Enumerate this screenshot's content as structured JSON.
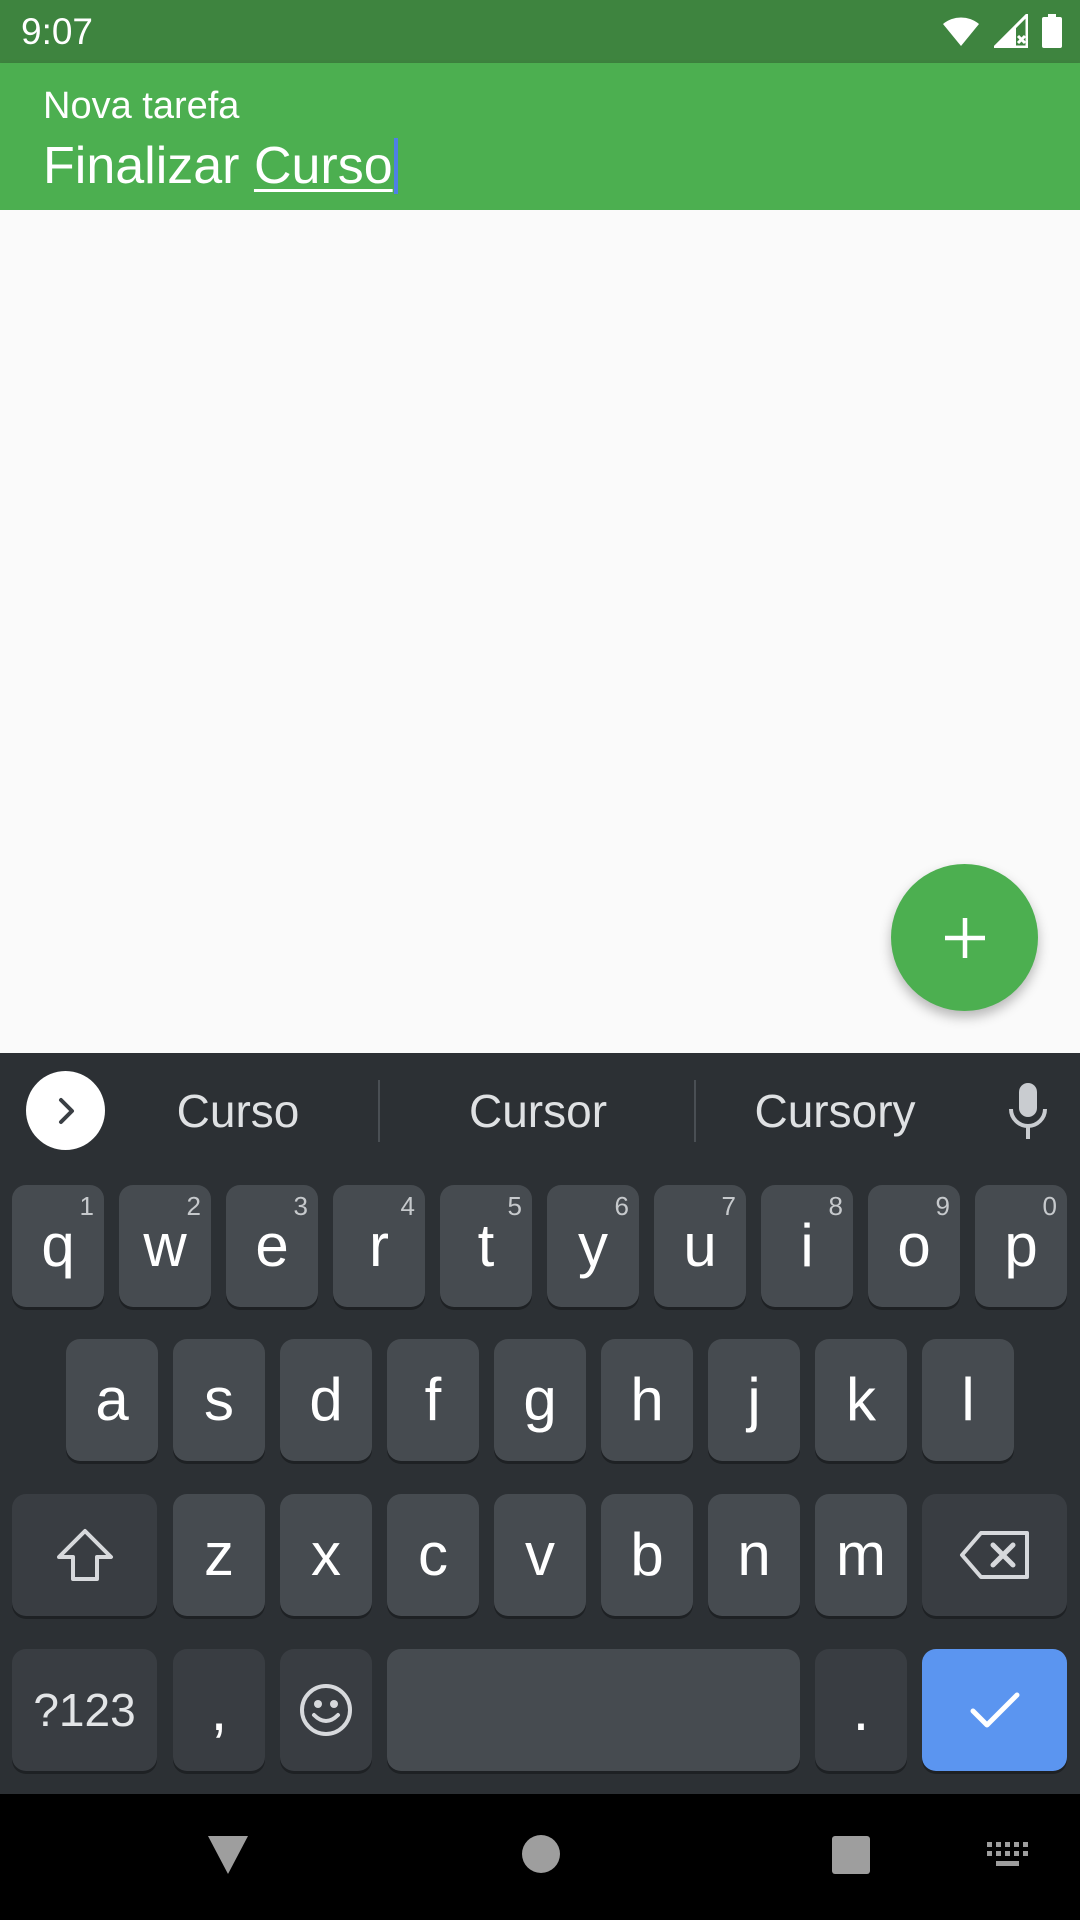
{
  "status_bar": {
    "time": "9:07",
    "icons": [
      "wifi-icon",
      "signal-icon",
      "battery-icon"
    ]
  },
  "task_input": {
    "label": "Nova tarefa",
    "text_prefix": "Finalizar ",
    "text_composing": "Curso"
  },
  "fab": {
    "icon": "add-icon",
    "color": "#4caf50"
  },
  "keyboard": {
    "suggestions": [
      "Curso",
      "Cursor",
      "Cursory"
    ],
    "row1": [
      {
        "label": "q",
        "hint": "1"
      },
      {
        "label": "w",
        "hint": "2"
      },
      {
        "label": "e",
        "hint": "3"
      },
      {
        "label": "r",
        "hint": "4"
      },
      {
        "label": "t",
        "hint": "5"
      },
      {
        "label": "y",
        "hint": "6"
      },
      {
        "label": "u",
        "hint": "7"
      },
      {
        "label": "i",
        "hint": "8"
      },
      {
        "label": "o",
        "hint": "9"
      },
      {
        "label": "p",
        "hint": "0"
      }
    ],
    "row2": [
      "a",
      "s",
      "d",
      "f",
      "g",
      "h",
      "j",
      "k",
      "l"
    ],
    "row3": [
      "z",
      "x",
      "c",
      "v",
      "b",
      "n",
      "m"
    ],
    "symbols_label": "?123",
    "comma_label": ",",
    "period_label": "."
  },
  "colors": {
    "status_bar": "#3e843f",
    "app_bar": "#4caf50",
    "keyboard_bg": "#2c3034",
    "key": "#464b50",
    "enter_key": "#5b95f0"
  }
}
